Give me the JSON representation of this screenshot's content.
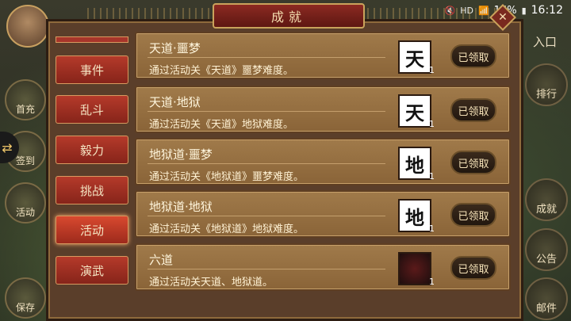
{
  "status_bar": {
    "icons": [
      "mute-icon",
      "hd-icon",
      "wifi-icon"
    ],
    "battery": "16%",
    "time": "16:12"
  },
  "header": {
    "title": "成就"
  },
  "top_right": {
    "entry_label": "入口"
  },
  "left_buttons": [
    {
      "label": "首充"
    },
    {
      "label": "签到"
    },
    {
      "label": "活动"
    },
    {
      "label": "保存"
    }
  ],
  "right_buttons": [
    {
      "label": "排行"
    },
    {
      "label": "成就"
    },
    {
      "label": "公告"
    },
    {
      "label": "邮件"
    }
  ],
  "categories": [
    {
      "label": "事件",
      "active": false
    },
    {
      "label": "乱斗",
      "active": false
    },
    {
      "label": "毅力",
      "active": false
    },
    {
      "label": "挑战",
      "active": false
    },
    {
      "label": "活动",
      "active": true
    },
    {
      "label": "演武",
      "active": false
    }
  ],
  "achievements": [
    {
      "title": "天道·噩梦",
      "desc": "通过活动关《天道》噩梦难度。",
      "reward_glyph": "天",
      "reward_qty": "1",
      "button": "已领取"
    },
    {
      "title": "天道·地狱",
      "desc": "通过活动关《天道》地狱难度。",
      "reward_glyph": "天",
      "reward_qty": "1",
      "button": "已领取"
    },
    {
      "title": "地狱道·噩梦",
      "desc": "通过活动关《地狱道》噩梦难度。",
      "reward_glyph": "地",
      "reward_qty": "1",
      "button": "已领取"
    },
    {
      "title": "地狱道·地狱",
      "desc": "通过活动关《地狱道》地狱难度。",
      "reward_glyph": "地",
      "reward_qty": "1",
      "button": "已领取"
    },
    {
      "title": "六道",
      "desc": "通过活动关天道、地狱道。",
      "reward_glyph": "",
      "reward_qty": "1",
      "button": "已领取"
    }
  ]
}
